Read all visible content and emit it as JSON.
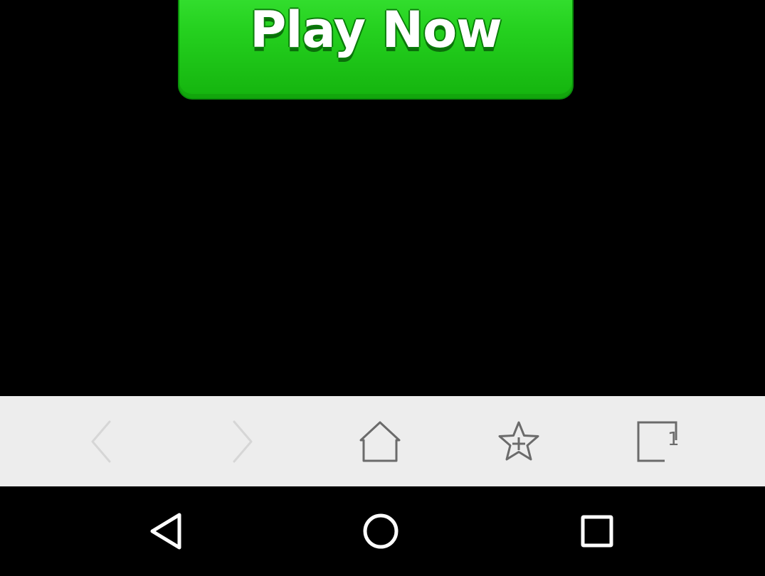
{
  "ad": {
    "play_button_label": "Play Now"
  },
  "browser_toolbar": {
    "back_icon": "chevron-left-icon",
    "forward_icon": "chevron-right-icon",
    "home_icon": "home-icon",
    "bookmark_icon": "star-plus-icon",
    "tabs_icon": "tabs-icon",
    "tabs_count": "1"
  },
  "nav_bar": {
    "back_icon": "triangle-back-icon",
    "home_icon": "circle-home-icon",
    "recents_icon": "square-recents-icon"
  },
  "colors": {
    "background": "#000000",
    "play_button_green": "#25d11f",
    "toolbar_bg": "#ededed",
    "toolbar_icon": "#6b6b6b",
    "toolbar_icon_disabled": "#d6d6d6"
  }
}
